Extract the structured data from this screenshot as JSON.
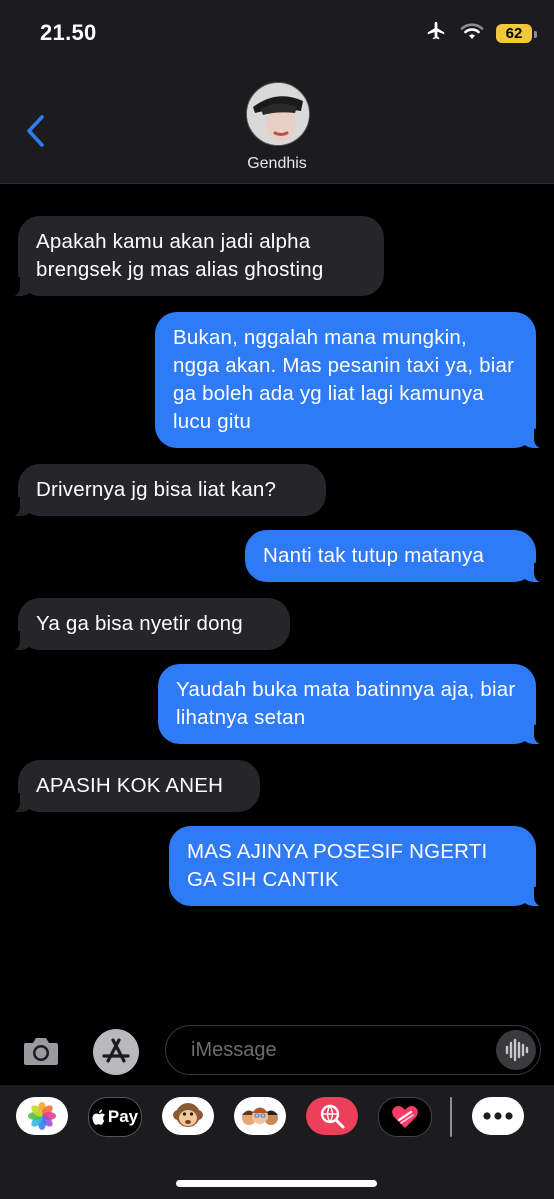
{
  "status_bar": {
    "time": "21.50",
    "battery": "62"
  },
  "header": {
    "contact_name": "Gendhis"
  },
  "messages": [
    {
      "side": "in",
      "text": "Apakah kamu akan jadi alpha brengsek jg mas alias ghosting"
    },
    {
      "side": "out",
      "text": "Bukan, nggalah mana mungkin, ngga akan. Mas pesanin taxi ya, biar ga boleh ada yg liat lagi kamunya lucu gitu"
    },
    {
      "side": "in",
      "text": "Drivernya jg bisa liat kan?"
    },
    {
      "side": "out",
      "text": "Nanti tak tutup matanya"
    },
    {
      "side": "in",
      "text": "Ya ga bisa nyetir dong"
    },
    {
      "side": "out",
      "text": "Yaudah buka mata batinnya aja, biar lihatnya setan"
    },
    {
      "side": "in",
      "text": "APASIH KOK ANEH"
    },
    {
      "side": "out",
      "text": "MAS AJINYA POSESIF NGERTI GA SIH CANTIK"
    }
  ],
  "composer": {
    "placeholder": "iMessage"
  },
  "app_tray": {
    "apple_pay_label": "Pay"
  },
  "colors": {
    "incoming_bubble": "#26262a",
    "outgoing_bubble": "#2f7bf6",
    "header_bg": "#1c1c1e",
    "accent": "#2f7bf6"
  },
  "icons": [
    "airplane-icon",
    "wifi-icon",
    "battery-icon",
    "back-chevron-icon",
    "camera-icon",
    "app-store-icon",
    "voice-waveform-icon",
    "photos-icon",
    "apple-pay-icon",
    "monkey-animoji-icon",
    "memoji-icon",
    "search-globe-icon",
    "digital-touch-icon",
    "more-icon"
  ]
}
